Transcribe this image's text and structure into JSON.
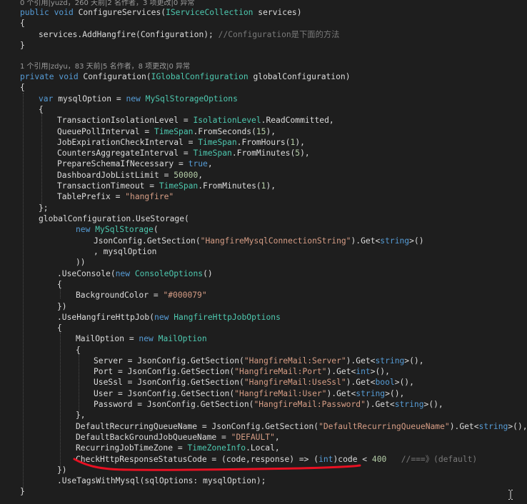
{
  "lens1": "0 个引用|yuzd，260 天前|2 名作者，3 项更改|0 异常",
  "lens2": "1 个引用|zdyu，83 天前|5 名作者，8 项更改|0 异常",
  "code": {
    "l1_kw": "public void ",
    "l1_name": "ConfigureServices(",
    "l1_type": "IServiceCollection",
    "l1_rest": " services)",
    "open_brace": "{",
    "close_brace": "}",
    "l3_code": "services.AddHangfire(Configuration); ",
    "l3_comment": "//Configuration是下面的方法",
    "l6_kw": "private void ",
    "l6_name": "Configuration(",
    "l6_type": "IGlobalConfiguration",
    "l6_rest": " globalConfiguration)",
    "var_kw": "var ",
    "var_name": "mysqlOption = ",
    "new_kw": "new ",
    "mso_type": "MySqlStorageOptions",
    "p1_a": "TransactionIsolationLevel = ",
    "p1_type": "IsolationLevel",
    "p1_b": ".ReadCommitted,",
    "p2_a": "QueuePollInterval = ",
    "ts": "TimeSpan",
    "p2_b": ".FromSeconds(",
    "p2_num": "15",
    "p_close": "),",
    "p3_a": "JobExpirationCheckInterval = ",
    "p3_b": ".FromHours(",
    "p3_num": "1",
    "p4_a": "CountersAggregateInterval = ",
    "p4_b": ".FromMinutes(",
    "p4_num": "5",
    "p5_a": "PrepareSchemaIfNecessary = ",
    "p5_kw": "true",
    "comma": ",",
    "p6_a": "DashboardJobListLimit = ",
    "p6_num": "50000",
    "p7_a": "TransactionTimeout = ",
    "p7_b": ".FromMinutes(",
    "p7_num": "1",
    "p8_a": "TablePrefix = ",
    "p8_str": "\"hangfire\"",
    "close_semi": "};",
    "us_line": "globalConfiguration.UseStorage(",
    "new_kw2": "new ",
    "ms_type": "MySqlStorage",
    "paren_open": "(",
    "jc_a": "JsonConfig.GetSection(",
    "jc_str": "\"HangfireMysqlConnectionString\"",
    "jc_b": ").Get<",
    "string_kw": "string",
    "jc_c": ">()",
    "mo_line": ", mysqlOption",
    "dparen": "))",
    "uc_a": ".UseConsole(",
    "uc_new": "new ",
    "uc_type": "ConsoleOptions",
    "uc_b": "()",
    "bg_a": "BackgroundColor = ",
    "bg_str": "\"#000079\"",
    "close_paren_brace": "})",
    "uh_a": ".UseHangfireHttpJob(",
    "uh_new": "new ",
    "uh_type": "HangfireHttpJobOptions",
    "mail_a": "MailOption = ",
    "mail_new": "new ",
    "mail_type": "MailOption",
    "srv_a": "Server = JsonConfig.GetSection(",
    "srv_str": "\"HangfireMail:Server\"",
    "get_open": ").Get<",
    "get_close": ">(),",
    "port_a": "Port = JsonConfig.GetSection(",
    "port_str": "\"HangfireMail:Port\"",
    "int_kw": "int",
    "ssl_a": "UseSsl = JsonConfig.GetSection(",
    "ssl_str": "\"HangfireMail:UseSsl\"",
    "bool_kw": "bool",
    "user_a": "User = JsonConfig.GetSection(",
    "user_str": "\"HangfireMail:User\"",
    "pwd_a": "Password = JsonConfig.GetSection(",
    "pwd_str": "\"HangfireMail:Password\"",
    "close_brace_comma": "},",
    "drq_a": "DefaultRecurringQueueName = JsonConfig.GetSection(",
    "drq_str": "\"DefaultRecurringQueueName\"",
    "dbj_a": "DefaultBackGroundJobQueueName = ",
    "dbj_str": "\"DEFAULT\"",
    "rtz_a": "RecurringJobTimeZone = ",
    "rtz_type": "TimeZoneInfo",
    "rtz_b": ".Local,",
    "chk_a": "CheckHttpResponseStatusCode = (code,response) => (",
    "chk_int": "int",
    "chk_b": ")code < ",
    "chk_num": "400",
    "chk_comment": "   //===》(default)",
    "ut_line": ".UseTagsWithMysql(sqlOptions: mysqlOption);"
  },
  "colors": {
    "background": "#1e1e1e",
    "keyword": "#569cd6",
    "type": "#4ec9b0",
    "string": "#d69d85",
    "number": "#b5cea8",
    "comment": "#57a64a",
    "annotation": "#e81123"
  },
  "icons": {
    "cursor": "text-ibeam-cursor-icon",
    "underline": "red-freehand-underline"
  }
}
